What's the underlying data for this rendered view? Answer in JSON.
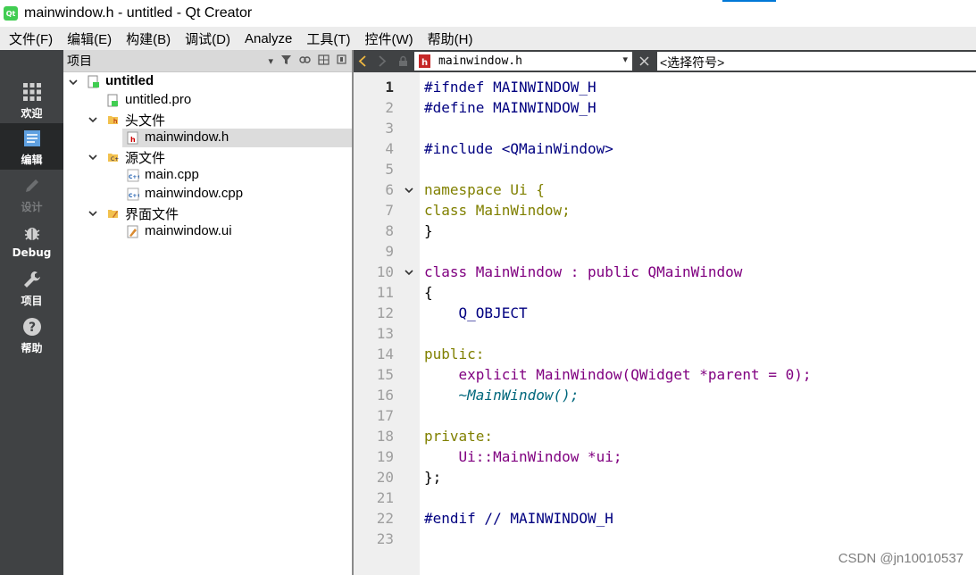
{
  "window": {
    "title": "mainwindow.h - untitled - Qt Creator",
    "app_icon_text": "Qt"
  },
  "menu": [
    {
      "label": "文件(F)"
    },
    {
      "label": "编辑(E)"
    },
    {
      "label": "构建(B)"
    },
    {
      "label": "调试(D)"
    },
    {
      "label": "Analyze"
    },
    {
      "label": "工具(T)"
    },
    {
      "label": "控件(W)"
    },
    {
      "label": "帮助(H)"
    }
  ],
  "modes": [
    {
      "label": "欢迎",
      "icon": "grid-icon",
      "active": false,
      "enabled": true
    },
    {
      "label": "编辑",
      "icon": "document-icon",
      "active": true,
      "enabled": true
    },
    {
      "label": "设计",
      "icon": "pencil-icon",
      "active": false,
      "enabled": false
    },
    {
      "label": "Debug",
      "icon": "bug-icon",
      "active": false,
      "enabled": true
    },
    {
      "label": "项目",
      "icon": "wrench-icon",
      "active": false,
      "enabled": true
    },
    {
      "label": "帮助",
      "icon": "question-icon",
      "active": false,
      "enabled": true
    }
  ],
  "project_panel": {
    "title": "项目",
    "tree": [
      {
        "label": "untitled",
        "kind": "project",
        "bold": true
      },
      {
        "label": "untitled.pro",
        "kind": "pro-file"
      },
      {
        "label": "头文件",
        "kind": "header-folder"
      },
      {
        "label": "mainwindow.h",
        "kind": "header-file",
        "selected": true
      },
      {
        "label": "源文件",
        "kind": "source-folder"
      },
      {
        "label": "main.cpp",
        "kind": "cpp-file"
      },
      {
        "label": "mainwindow.cpp",
        "kind": "cpp-file"
      },
      {
        "label": "界面文件",
        "kind": "form-folder"
      },
      {
        "label": "mainwindow.ui",
        "kind": "ui-file"
      }
    ]
  },
  "editor": {
    "open_file": "mainwindow.h",
    "symbol_placeholder": "<选择符号>",
    "current_line": 1,
    "line_numbers": [
      "1",
      "2",
      "3",
      "4",
      "5",
      "6",
      "7",
      "8",
      "9",
      "10",
      "11",
      "12",
      "13",
      "14",
      "15",
      "16",
      "17",
      "18",
      "19",
      "20",
      "21",
      "22",
      "23"
    ],
    "code_lines": [
      "#ifndef MAINWINDOW_H",
      "#define MAINWINDOW_H",
      "",
      "#include <QMainWindow>",
      "",
      "namespace Ui {",
      "class MainWindow;",
      "}",
      "",
      "class MainWindow : public QMainWindow",
      "{",
      "    Q_OBJECT",
      "",
      "public:",
      "    explicit MainWindow(QWidget *parent = 0);",
      "    ~MainWindow();",
      "",
      "private:",
      "    Ui::MainWindow *ui;",
      "};",
      "",
      "#endif // MAINWINDOW_H",
      ""
    ]
  },
  "watermark": "CSDN @jn10010537",
  "colors": {
    "modebar_bg": "#404244",
    "modebar_active": "#262829",
    "keyword": "#808000",
    "type": "#800080",
    "preprocessor": "#000080",
    "string": "#008000"
  }
}
